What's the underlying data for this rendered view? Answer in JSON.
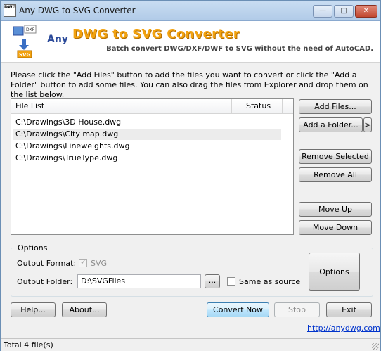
{
  "window": {
    "title": "Any DWG to SVG Converter",
    "icon_label": "DWG",
    "controls": [
      "minimize-icon",
      "maximize-icon",
      "close-icon"
    ]
  },
  "banner": {
    "any": "Any",
    "title": "DWG to SVG Converter",
    "subtitle": "Batch convert DWG/DXF/DWF to SVG without the need of AutoCAD.",
    "badge_dxf": "DXF",
    "badge_svg": "SVG"
  },
  "instructions": "Please click the \"Add Files\" button to add the files you want to convert or click the \"Add a Folder\" button to add some files. You can also drag the files from Explorer and drop them on the list below.",
  "file_list": {
    "columns": [
      "File List",
      "Status"
    ],
    "rows": [
      {
        "file": "C:\\Drawings\\3D House.dwg",
        "status": ""
      },
      {
        "file": "C:\\Drawings\\City map.dwg",
        "status": ""
      },
      {
        "file": "C:\\Drawings\\Lineweights.dwg",
        "status": ""
      },
      {
        "file": "C:\\Drawings\\TrueType.dwg",
        "status": ""
      }
    ]
  },
  "side_buttons": {
    "add_files": "Add Files...",
    "add_folder": "Add a Folder...",
    "add_folder_more": ">",
    "remove_selected": "Remove Selected",
    "remove_all": "Remove All",
    "move_up": "Move Up",
    "move_down": "Move Down"
  },
  "options": {
    "group_label": "Options",
    "output_format_label": "Output Format:",
    "output_format_value": "SVG",
    "output_folder_label": "Output Folder:",
    "output_folder_value": "D:\\SVGFiles",
    "browse": "...",
    "same_as_source": "Same as source",
    "options_button": "Options"
  },
  "bottom_buttons": {
    "help": "Help...",
    "about": "About...",
    "convert_now": "Convert Now",
    "stop": "Stop",
    "exit": "Exit"
  },
  "link": "http://anydwg.com",
  "status": "Total 4 file(s)"
}
